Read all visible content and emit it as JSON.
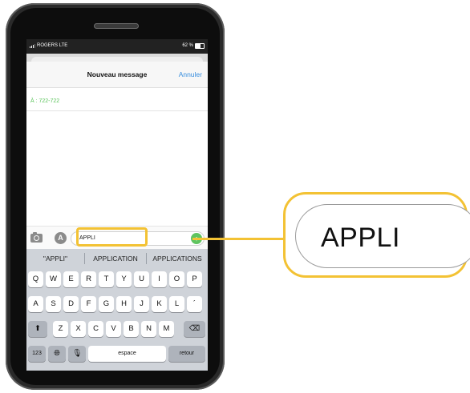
{
  "status_bar": {
    "carrier": "ROGERS LTE",
    "battery": "62 %"
  },
  "nav": {
    "title": "Nouveau message",
    "cancel": "Annuler"
  },
  "recipient": {
    "label": "À : 722-722"
  },
  "compose": {
    "text": "APPLI",
    "send_icon": "arrow-up-icon"
  },
  "suggestions": [
    "\"APPLI\"",
    "APPLICATION",
    "APPLICATIONS"
  ],
  "keyboard": {
    "row1": [
      "Q",
      "W",
      "E",
      "R",
      "T",
      "Y",
      "U",
      "I",
      "O",
      "P"
    ],
    "row2": [
      "A",
      "S",
      "D",
      "F",
      "G",
      "H",
      "J",
      "K",
      "L",
      "´"
    ],
    "row3": [
      "Z",
      "X",
      "C",
      "V",
      "B",
      "N",
      "M"
    ],
    "numbers": "123",
    "space": "espace",
    "return": "retour",
    "shift_icon": "shift-arrow-icon",
    "delete_icon": "backspace-icon",
    "globe_icon": "globe-icon",
    "mic_icon": "microphone-icon"
  },
  "callout": {
    "text": "APPLI",
    "accent_color": "#f3c234"
  }
}
